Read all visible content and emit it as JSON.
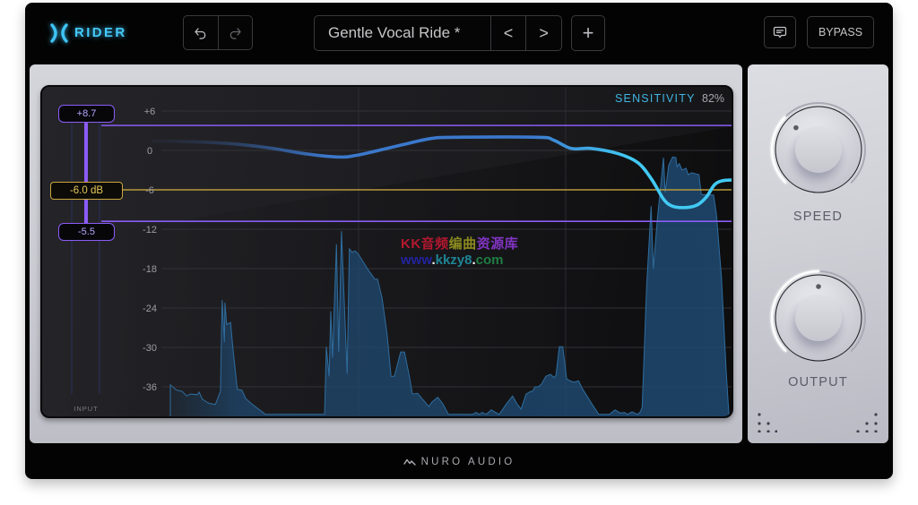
{
  "app": {
    "logo_icon": "rider-x-logo-icon",
    "logo_text": "RIDER"
  },
  "toolbar": {
    "undo_icon": "undo-icon",
    "redo_icon": "redo-icon",
    "preset_name": "Gentle Vocal Ride *",
    "prev_label": "<",
    "next_label": ">",
    "add_label": "+",
    "comment_icon": "comment-icon",
    "bypass_label": "BYPASS"
  },
  "display": {
    "sensitivity_label": "SENSITIVITY",
    "sensitivity_value": "82%",
    "y_ticks": [
      {
        "label": "+6",
        "db": 6
      },
      {
        "label": "0",
        "db": 0
      },
      {
        "label": "-6",
        "db": -6
      },
      {
        "label": "-12",
        "db": -12
      },
      {
        "label": "-18",
        "db": -18
      },
      {
        "label": "-24",
        "db": -24
      },
      {
        "label": "-30",
        "db": -30
      },
      {
        "label": "-36",
        "db": -36
      }
    ],
    "target_db": -6,
    "target_label": "-6.0 dB",
    "range_upper_label": "+8.7",
    "range_lower_label": "-5.5",
    "range_upper_line_db": 3.8,
    "range_lower_line_db": -10.8,
    "meter_label": "INPUT",
    "waveform_floor_db": -40.2,
    "waveform": [
      [
        0,
        -35.7
      ],
      [
        1.1,
        -36.5
      ],
      [
        2.1,
        -36.7
      ],
      [
        2.9,
        -37.4
      ],
      [
        3.5,
        -37.1
      ],
      [
        4.8,
        -37.2
      ],
      [
        5.1,
        -36.8
      ],
      [
        5.7,
        -37.9
      ],
      [
        6.8,
        -38.5
      ],
      [
        8.0,
        -38.7
      ],
      [
        8.4,
        -37.8
      ],
      [
        8.9,
        -36.7
      ],
      [
        9.2,
        -22.8
      ],
      [
        9.6,
        -29.2
      ],
      [
        9.7,
        -23.2
      ],
      [
        10.0,
        -26.5
      ],
      [
        10.7,
        -26.2
      ],
      [
        11.1,
        -30.0
      ],
      [
        11.9,
        -36.4
      ],
      [
        12.7,
        -36.5
      ],
      [
        13.4,
        -37.8
      ],
      [
        14.3,
        -38.5
      ],
      [
        16.9,
        -40.2
      ],
      [
        27.4,
        -40.2
      ],
      [
        27.7,
        -29.9
      ],
      [
        28.2,
        -34.4
      ],
      [
        28.5,
        -24.5
      ],
      [
        28.8,
        -31.6
      ],
      [
        29.5,
        -14.3
      ],
      [
        29.9,
        -30.7
      ],
      [
        30.4,
        -12.3
      ],
      [
        31.4,
        -34.0
      ],
      [
        31.8,
        -15.0
      ],
      [
        32.3,
        -15.5
      ],
      [
        32.8,
        -15.3
      ],
      [
        33.4,
        -15.8
      ],
      [
        35.0,
        -18.0
      ],
      [
        36.3,
        -19.6
      ],
      [
        36.8,
        -19.6
      ],
      [
        37.6,
        -22.4
      ],
      [
        38.5,
        -28.0
      ],
      [
        39.2,
        -34.4
      ],
      [
        39.8,
        -34.4
      ],
      [
        40.9,
        -30.7
      ],
      [
        41.6,
        -30.7
      ],
      [
        42.5,
        -34.6
      ],
      [
        43.0,
        -37.1
      ],
      [
        43.9,
        -37.0
      ],
      [
        45.9,
        -39.0
      ],
      [
        46.5,
        -38.3
      ],
      [
        47.5,
        -37.6
      ],
      [
        48.4,
        -38.6
      ],
      [
        49.4,
        -40.2
      ],
      [
        53.7,
        -40.2
      ],
      [
        54.3,
        -39.9
      ],
      [
        54.9,
        -40.2
      ],
      [
        55.4,
        -39.9
      ],
      [
        56.1,
        -40.2
      ],
      [
        57.0,
        -39.5
      ],
      [
        57.6,
        -39.8
      ],
      [
        58.4,
        -40.2
      ],
      [
        59.7,
        -38.6
      ],
      [
        60.8,
        -37.4
      ],
      [
        61.5,
        -38.5
      ],
      [
        62.3,
        -39.4
      ],
      [
        63.2,
        -37.1
      ],
      [
        64.0,
        -36.7
      ],
      [
        64.3,
        -36.7
      ],
      [
        64.8,
        -36.0
      ],
      [
        65.3,
        -36.0
      ],
      [
        65.9,
        -35.6
      ],
      [
        66.7,
        -34.4
      ],
      [
        67.5,
        -34.1
      ],
      [
        68.2,
        -34.6
      ],
      [
        68.5,
        -34.2
      ],
      [
        69.1,
        -29.9
      ],
      [
        69.7,
        -29.9
      ],
      [
        70.4,
        -34.8
      ],
      [
        71.0,
        -35.1
      ],
      [
        71.7,
        -35.3
      ],
      [
        72.5,
        -35.1
      ],
      [
        73.2,
        -36.3
      ],
      [
        74.8,
        -38.5
      ],
      [
        76.1,
        -40.2
      ],
      [
        78.0,
        -40.2
      ],
      [
        79.0,
        -39.5
      ],
      [
        79.9,
        -40.0
      ],
      [
        80.7,
        -39.9
      ],
      [
        81.2,
        -40.2
      ],
      [
        82.0,
        -39.8
      ],
      [
        83.0,
        -40.2
      ],
      [
        83.5,
        -39.8
      ],
      [
        83.8,
        -39.1
      ],
      [
        84.6,
        -20.7
      ],
      [
        85.4,
        -8.5
      ],
      [
        85.8,
        -18.0
      ],
      [
        86.5,
        -10.5
      ],
      [
        87.6,
        -1.1
      ],
      [
        87.9,
        -6.4
      ],
      [
        88.5,
        -2.3
      ],
      [
        89.2,
        -1.0
      ],
      [
        89.8,
        -1.1
      ],
      [
        90.0,
        -2.5
      ],
      [
        90.4,
        -2.0
      ],
      [
        90.9,
        -3.0
      ],
      [
        91.6,
        -2.7
      ],
      [
        92.0,
        -3.7
      ],
      [
        92.6,
        -3.4
      ],
      [
        93.9,
        -3.7
      ],
      [
        94.3,
        -6.7
      ],
      [
        96.5,
        -6.8
      ],
      [
        97.0,
        -9.8
      ],
      [
        97.9,
        -19.4
      ],
      [
        98.7,
        -33.0
      ],
      [
        99.2,
        -40.1
      ]
    ],
    "gain_curve": [
      [
        -3,
        1.4
      ],
      [
        0,
        1.4
      ],
      [
        9.6,
        1.1
      ],
      [
        17.5,
        0.4
      ],
      [
        23.9,
        -0.5
      ],
      [
        29.8,
        -1.0
      ],
      [
        33.4,
        -0.7
      ],
      [
        40.9,
        0.8
      ],
      [
        46.2,
        1.8
      ],
      [
        50.5,
        2.0
      ],
      [
        65.3,
        2.0
      ],
      [
        68.0,
        1.6
      ],
      [
        71.2,
        0.3
      ],
      [
        74.8,
        0.3
      ],
      [
        79.6,
        -0.5
      ],
      [
        83.1,
        -1.9
      ],
      [
        85.5,
        -4.4
      ],
      [
        87.6,
        -7.4
      ],
      [
        89.2,
        -8.5
      ],
      [
        91.6,
        -8.7
      ],
      [
        93.6,
        -8.3
      ],
      [
        95.2,
        -7.1
      ],
      [
        96.7,
        -5.2
      ],
      [
        98.2,
        -4.6
      ],
      [
        100,
        -4.5
      ]
    ],
    "colors": {
      "range": "#8b5cf6",
      "target": "#b8993a",
      "gain_start": "#2b3550",
      "gain_mid": "#3b78cc",
      "gain_end": "#41c9f3",
      "waveform_fill": "#1f4a72",
      "waveform_stroke": "#2f6d9e",
      "grid": "#323237"
    }
  },
  "knobs": [
    {
      "id": "speed",
      "label": "SPEED",
      "value": 0.33
    },
    {
      "id": "output",
      "label": "OUTPUT",
      "value": 0.5
    }
  ],
  "footer": {
    "logo_icon": "nuro-wave-logo-icon",
    "brand": "NURO AUDIO"
  },
  "watermark": {
    "line1": [
      {
        "text": "KK音频",
        "color": "#b3182f"
      },
      {
        "text": "编曲",
        "color": "#8c8a1e"
      },
      {
        "text": "资源库",
        "color": "#8234c4"
      }
    ],
    "line2": [
      {
        "text": "www",
        "color": "#23239f"
      },
      {
        "text": ".",
        "color": "#ffffff"
      },
      {
        "text": "kkzy8",
        "color": "#1f8494"
      },
      {
        "text": ".",
        "color": "#ffffff"
      },
      {
        "text": "com",
        "color": "#1f7d42"
      }
    ]
  }
}
